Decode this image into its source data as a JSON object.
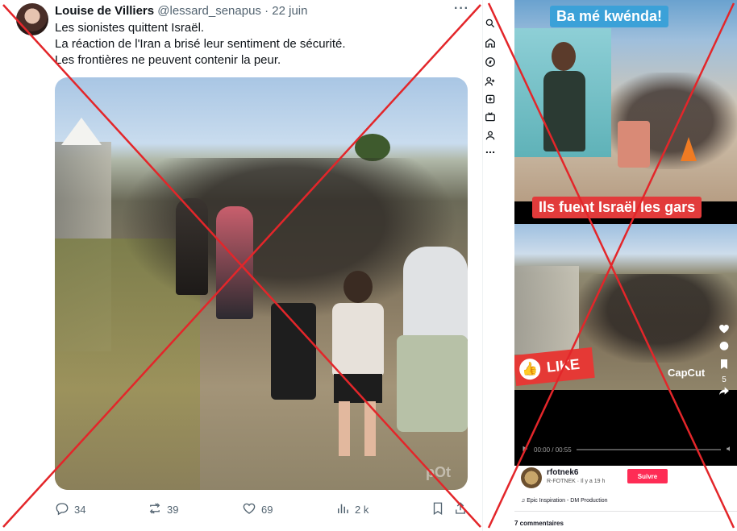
{
  "tweet": {
    "author_name": "Louise de Villiers",
    "author_handle": "@lessard_senapus",
    "separator": "·",
    "date": "22 juin",
    "more": "···",
    "lines": [
      "Les sionistes quittent Israël.",
      "La réaction de l'Iran a brisé leur sentiment de sécurité.",
      "Les frontières ne peuvent contenir la peur."
    ],
    "media_watermark": "pOt",
    "actions": {
      "replies": "34",
      "reposts": "39",
      "likes": "69",
      "views": "2 k"
    }
  },
  "tiktok": {
    "caption_top": "Ba mé kwénda!",
    "caption_middle": "Ils fuent Israël les gars",
    "like_label": "LIKE",
    "watermark": "CapCut",
    "share_count": "5",
    "time": "00:00 / 00:55",
    "username": "rfotnek6",
    "user_meta": "R-FOTNEK · Il y a 19 h",
    "follow_label": "Suivre",
    "music": "♫ Epic Inspiration - DM Production",
    "comments": "7 commentaires"
  },
  "colors": {
    "cross": "#e3262a",
    "twitter_text": "#0f1419",
    "twitter_muted": "#536471",
    "tiktok_red": "#fe2c55"
  }
}
